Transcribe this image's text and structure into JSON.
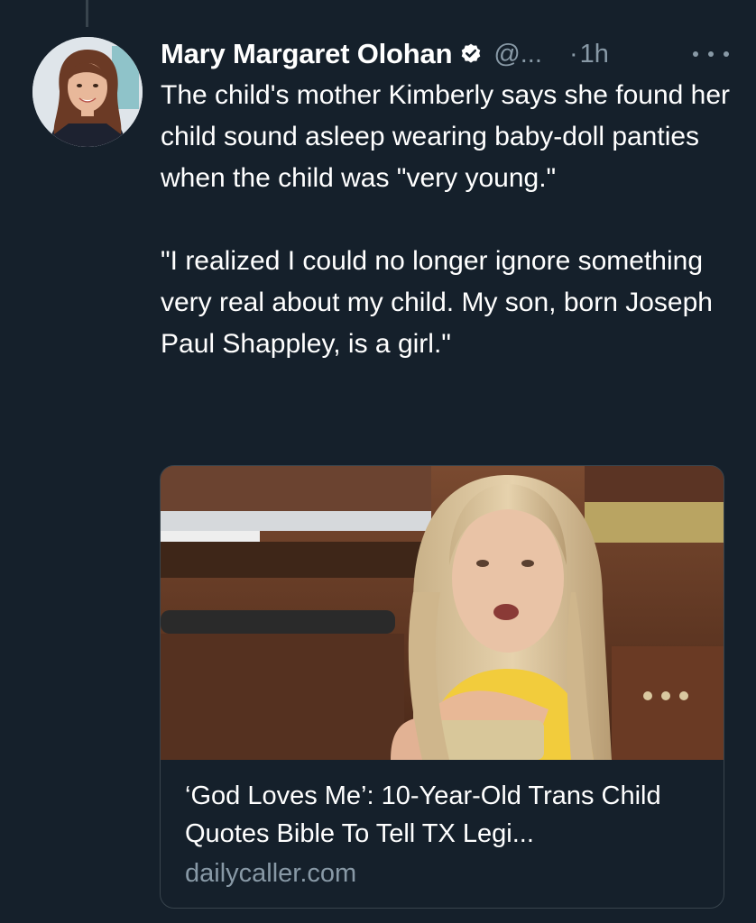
{
  "tweet": {
    "author_name": "Mary Margaret Olohan",
    "handle": "@...",
    "separator": "·",
    "time": "1h",
    "paragraphs": [
      "The child's mother Kimberly says she found her child sound asleep wearing baby-doll panties when the child was \"very young.\"",
      "\"I realized I could no longer ignore something very real about my child. My son, born Joseph Paul Shappley, is a girl.\""
    ]
  },
  "card": {
    "title": "‘God Loves Me’: 10-Year-Old Trans Child Quotes Bible To Tell TX Legi...",
    "domain": "dailycaller.com"
  },
  "colors": {
    "background": "#15202b",
    "text": "#ffffff",
    "secondary": "#8899a6",
    "border": "#38444d"
  },
  "icons": [
    "verified-badge-icon",
    "more-options-icon"
  ]
}
